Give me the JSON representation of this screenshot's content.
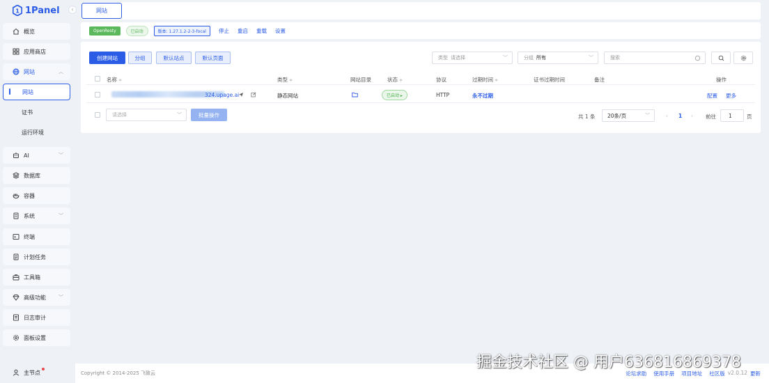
{
  "sidebar": {
    "logo_text": "1Panel",
    "items": [
      {
        "label": "概览",
        "icon": "home-icon"
      },
      {
        "label": "应用商店",
        "icon": "grid-icon"
      },
      {
        "label": "网站",
        "icon": "globe-icon"
      },
      {
        "label": "网站"
      },
      {
        "label": "证书"
      },
      {
        "label": "运行环境"
      },
      {
        "label": "AI",
        "icon": "robot-icon"
      },
      {
        "label": "数据库",
        "icon": "database-icon"
      },
      {
        "label": "容器",
        "icon": "container-icon"
      },
      {
        "label": "系统",
        "icon": "system-icon"
      },
      {
        "label": "终端",
        "icon": "terminal-icon"
      },
      {
        "label": "计划任务",
        "icon": "task-icon"
      },
      {
        "label": "工具箱",
        "icon": "toolbox-icon"
      },
      {
        "label": "高级功能",
        "icon": "diamond-icon"
      },
      {
        "label": "日志审计",
        "icon": "log-icon"
      },
      {
        "label": "面板设置",
        "icon": "settings-icon"
      }
    ],
    "user_label": "主节点"
  },
  "tabbar": {
    "active_tab": "网站"
  },
  "appbar": {
    "app_name": "OpenResty",
    "status": "已启动",
    "version": "版本: 1.27.1.2-2-3-focal",
    "actions": [
      "停止",
      "重启",
      "重载",
      "设置"
    ]
  },
  "toolbar": {
    "create_label": "创建网站",
    "group_label": "分组",
    "default_site_label": "默认站点",
    "default_page_label": "默认页面",
    "type_filter_label": "类型",
    "type_filter_placeholder": "请选择",
    "group_filter_label": "分组",
    "group_filter_value": "所有",
    "search_placeholder": "搜索"
  },
  "table": {
    "columns": [
      "名称",
      "类型",
      "网站目录",
      "状态",
      "协议",
      "过期时间",
      "证书过期时间",
      "备注",
      "操作"
    ],
    "rows": [
      {
        "name_suffix": "324.upage.ai",
        "type": "静态网站",
        "status": "已启动",
        "protocol": "HTTP",
        "expire": "永不过期",
        "actions": [
          "配置",
          "更多"
        ]
      }
    ]
  },
  "batch": {
    "placeholder": "请选择",
    "button_label": "批量操作"
  },
  "pager": {
    "total": "共 1 条",
    "page_size": "20条/页",
    "current_page": "1",
    "goto_label": "前往",
    "goto_value": "1",
    "page_suffix": "页"
  },
  "footer": {
    "copyright": "Copyright © 2014-2025 飞致云",
    "links": [
      "论坛求助",
      "使用手册",
      "项目地址",
      "社区版"
    ],
    "version": "v2.0.12",
    "update_label": "更新"
  },
  "watermark": "掘金技术社区 @ 用户636816869378",
  "colors": {
    "accent": "#2b5ce6",
    "success": "#5cb85c",
    "background": "#eef1f6"
  }
}
